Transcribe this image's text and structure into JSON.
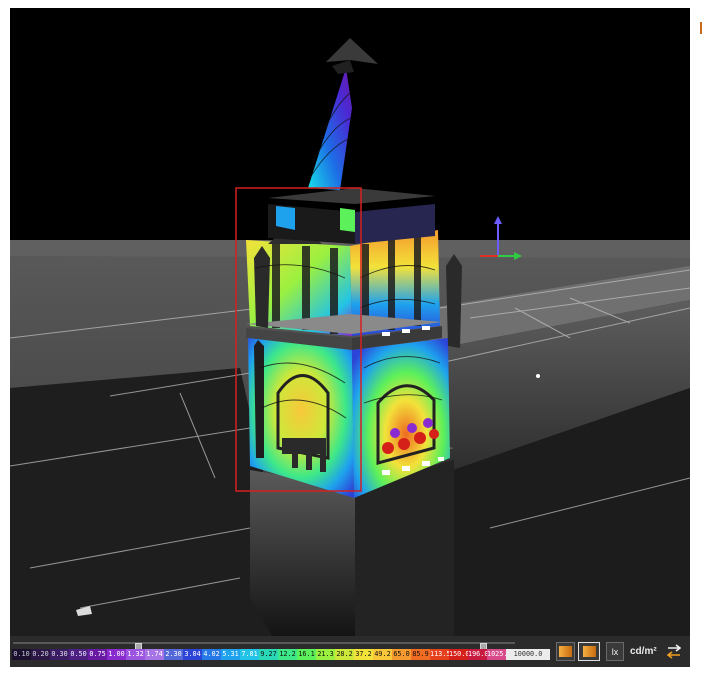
{
  "scale": {
    "labels": [
      "0.10",
      "0.20",
      "0.30",
      "0.50",
      "0.75",
      "1.00",
      "1.32",
      "1.74",
      "2.30",
      "3.04",
      "4.02",
      "5.31",
      "7.01",
      "9.27",
      "12.2",
      "16.1",
      "21.3",
      "28.2",
      "37.2",
      "49.2",
      "65.0",
      "85.9",
      "113.5",
      "150.0",
      "196.0",
      "1025.0",
      "10000.0"
    ],
    "colors": [
      "#1a0f2c",
      "#2c1746",
      "#3a1d63",
      "#4e1f82",
      "#681aa4",
      "#8a2bd0",
      "#9b55e0",
      "#a774e6",
      "#5568d8",
      "#2c44d8",
      "#2578e6",
      "#1ea2ee",
      "#22c3e6",
      "#2ad8b8",
      "#3ee888",
      "#5cf05a",
      "#9af040",
      "#cde83a",
      "#f3e23a",
      "#f8c83a",
      "#f59a2e",
      "#ef6c22",
      "#e6401c",
      "#d42018",
      "#c81a40",
      "#d84a8a",
      "#ececec"
    ],
    "text_colors": [
      "#c8c8d8",
      "#d0d0e0",
      "#e0e0f0",
      "#ececff",
      "#ffffff",
      "#ffffff",
      "#ffffff",
      "#ffffff",
      "#ffffff",
      "#ffffff",
      "#ffffff",
      "#ffffff",
      "#ffffff",
      "#111111",
      "#111111",
      "#111111",
      "#111111",
      "#111111",
      "#111111",
      "#111111",
      "#111111",
      "#111111",
      "#ffffff",
      "#ffffff",
      "#ffffff",
      "#ffffff",
      "#333333"
    ],
    "lower_handle_fraction": 0.244,
    "upper_handle_fraction": 0.931
  },
  "toolbar": {
    "unit_lx": "lx",
    "unit_cd": "cd/m²",
    "gradient_colors": [
      "#f6b040",
      "#c66a12"
    ]
  },
  "scene": {
    "sky_color": "#000000",
    "ground_color": "#4a4a4a",
    "selection_color": "#d42020",
    "gizmo_colors": [
      "#2ecc40",
      "#e0302a",
      "#6a5cff"
    ]
  }
}
